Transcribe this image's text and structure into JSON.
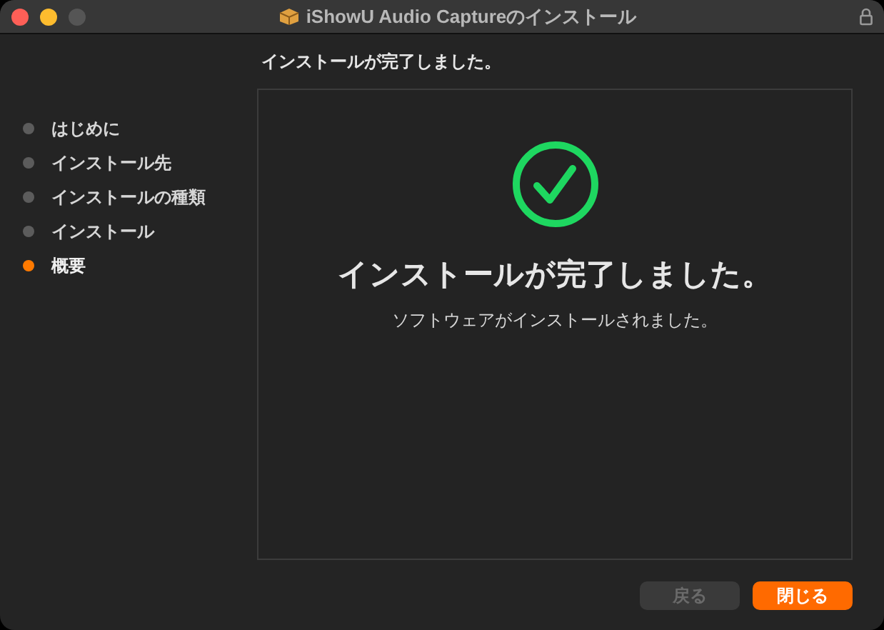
{
  "window": {
    "title": "iShowU Audio Captureのインストール"
  },
  "header": "インストールが完了しました。",
  "sidebar": {
    "items": [
      {
        "label": "はじめに",
        "selected": false
      },
      {
        "label": "インストール先",
        "selected": false
      },
      {
        "label": "インストールの種類",
        "selected": false
      },
      {
        "label": "インストール",
        "selected": false
      },
      {
        "label": "概要",
        "selected": true
      }
    ]
  },
  "content": {
    "heading": "インストールが完了しました。",
    "message": "ソフトウェアがインストールされました。"
  },
  "buttons": [
    {
      "label": "戻る",
      "disabled": true
    },
    {
      "label": "閉じる",
      "disabled": false
    }
  ]
}
